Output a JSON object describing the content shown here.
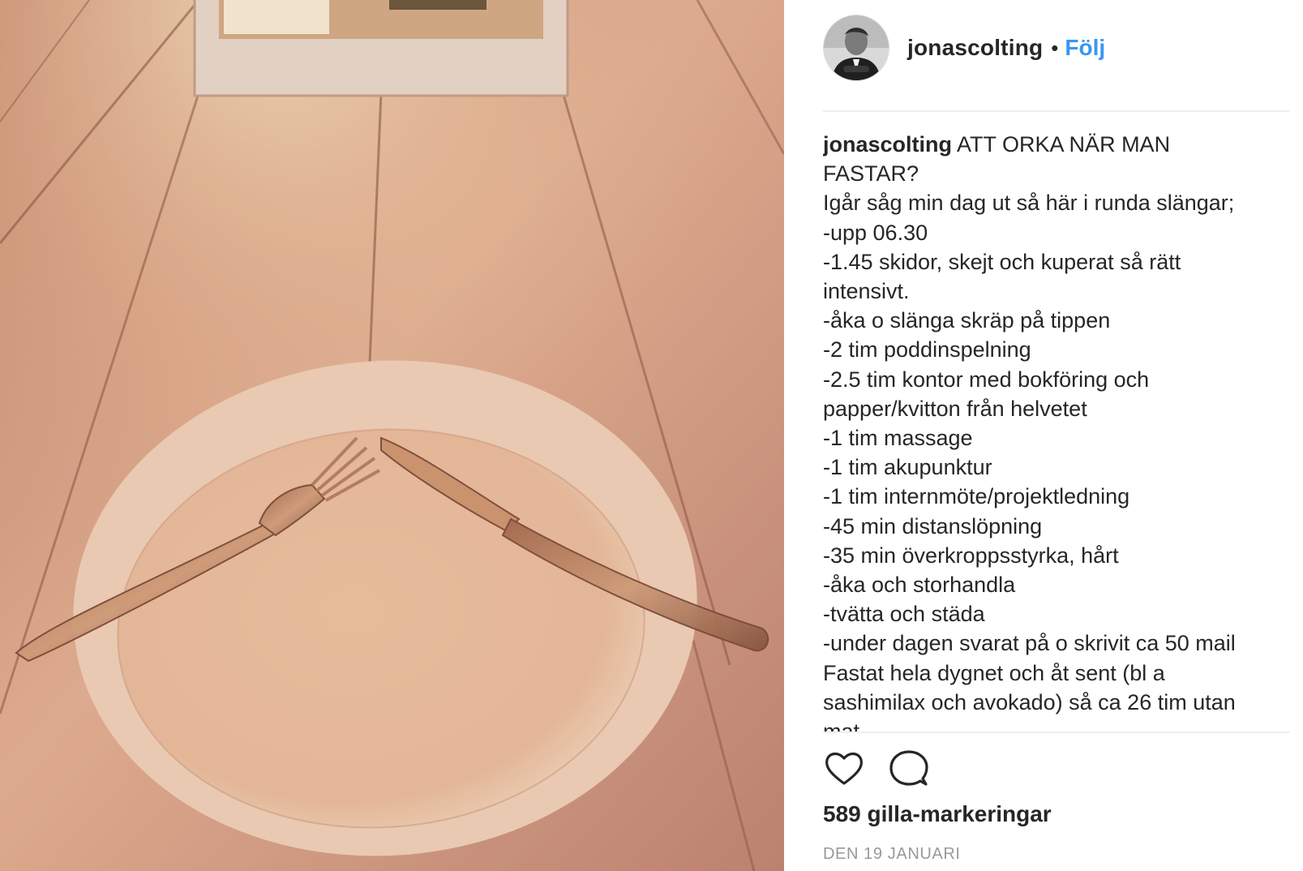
{
  "header": {
    "username": "jonascolting",
    "separator": "•",
    "follow_label": "Följ"
  },
  "caption": {
    "username": "jonascolting",
    "lines": [
      " ATT ORKA NÄR MAN",
      "FASTAR?",
      "Igår såg min dag ut så här i runda slängar;",
      "-upp 06.30",
      "-1.45 skidor, skejt och kuperat så rätt",
      "intensivt.",
      "-åka o slänga skräp på tippen",
      "-2 tim poddinspelning",
      "-2.5 tim kontor med bokföring och",
      "papper/kvitton från helvetet",
      "-1 tim massage",
      "-1 tim akupunktur",
      "-1 tim internmöte/projektledning",
      "-45 min distanslöpning",
      "-35 min överkroppsstyrka, hårt",
      "-åka och storhandla",
      "-tvätta och städa",
      "-under dagen svarat på o skrivit ca 50 mail",
      "Fastat hela dygnet och åt sent (bl a",
      "sashimilax och avokado) så ca 26 tim utan",
      "mat"
    ]
  },
  "actions": {
    "like_icon": "heart-icon",
    "comment_icon": "comment-bubble-icon"
  },
  "likes_text": "589 gilla-markeringar",
  "date_text": "DEN 19 JANUARI",
  "colors": {
    "follow": "#3897f0",
    "text": "#262626",
    "muted": "#999999",
    "divider": "#efefef"
  }
}
